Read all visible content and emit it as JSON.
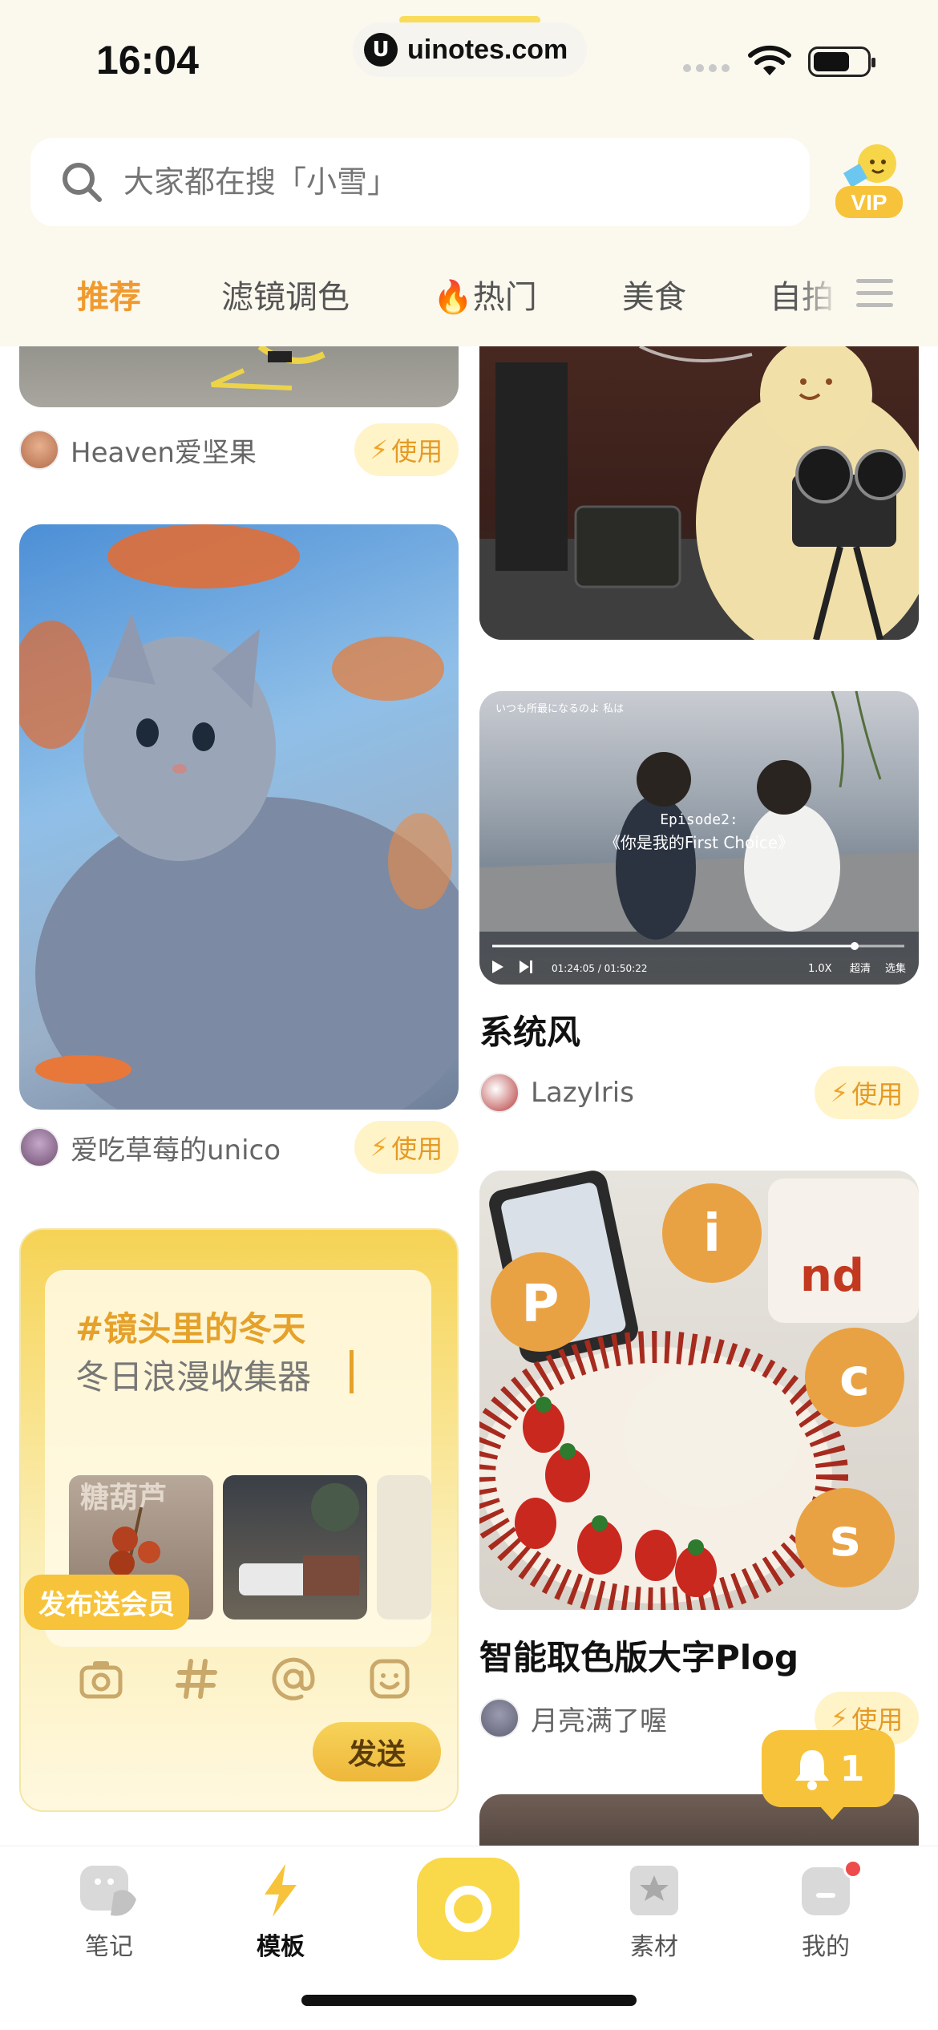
{
  "status_bar": {
    "time": "16:04",
    "url": "uinotes.com"
  },
  "search": {
    "placeholder": "大家都在搜「小雪」"
  },
  "badges": {
    "vip": "VIP"
  },
  "tabs": [
    {
      "label": "推荐",
      "active": true
    },
    {
      "label": "滤镜调色"
    },
    {
      "label": "🔥热门"
    },
    {
      "label": "美食"
    },
    {
      "label": "自拍"
    }
  ],
  "feed": {
    "use_label": "使用",
    "cards": [
      {
        "author": "Heaven爱坚果"
      },
      {
        "author": "爱吃草莓的unico"
      },
      {
        "title": "系统风",
        "author": "LazyIris",
        "video": {
          "episode": "Episode2:",
          "caption": "《你是我的First Choice》",
          "time": "01:24:05 / 01:50:22",
          "speed": "1.0X",
          "quality": "超清",
          "select": "选集",
          "top_text": "いつも所最になるのよ 私は"
        }
      },
      {
        "title": "智能取色版大字Plog",
        "author": "月亮满了喔",
        "letters": [
          "P",
          "i",
          "c",
          "s"
        ]
      }
    ],
    "publish_card": {
      "hashtag": "#镜头里的冬天",
      "subtitle": "冬日浪漫收集器",
      "thumb_text": "糖葫芦",
      "badge": "发布送会员",
      "send": "发送",
      "tools": [
        "camera-icon",
        "hash-icon",
        "at-icon",
        "emoji-icon"
      ]
    }
  },
  "notification": {
    "count": "1"
  },
  "tabbar": [
    {
      "label": "笔记"
    },
    {
      "label": "模板",
      "active": true
    },
    {
      "label": "素材"
    },
    {
      "label": "我的"
    }
  ],
  "colors": {
    "accent": "#f09a2e",
    "yellow": "#f7c33a",
    "bg_header": "#fbf8ee"
  }
}
